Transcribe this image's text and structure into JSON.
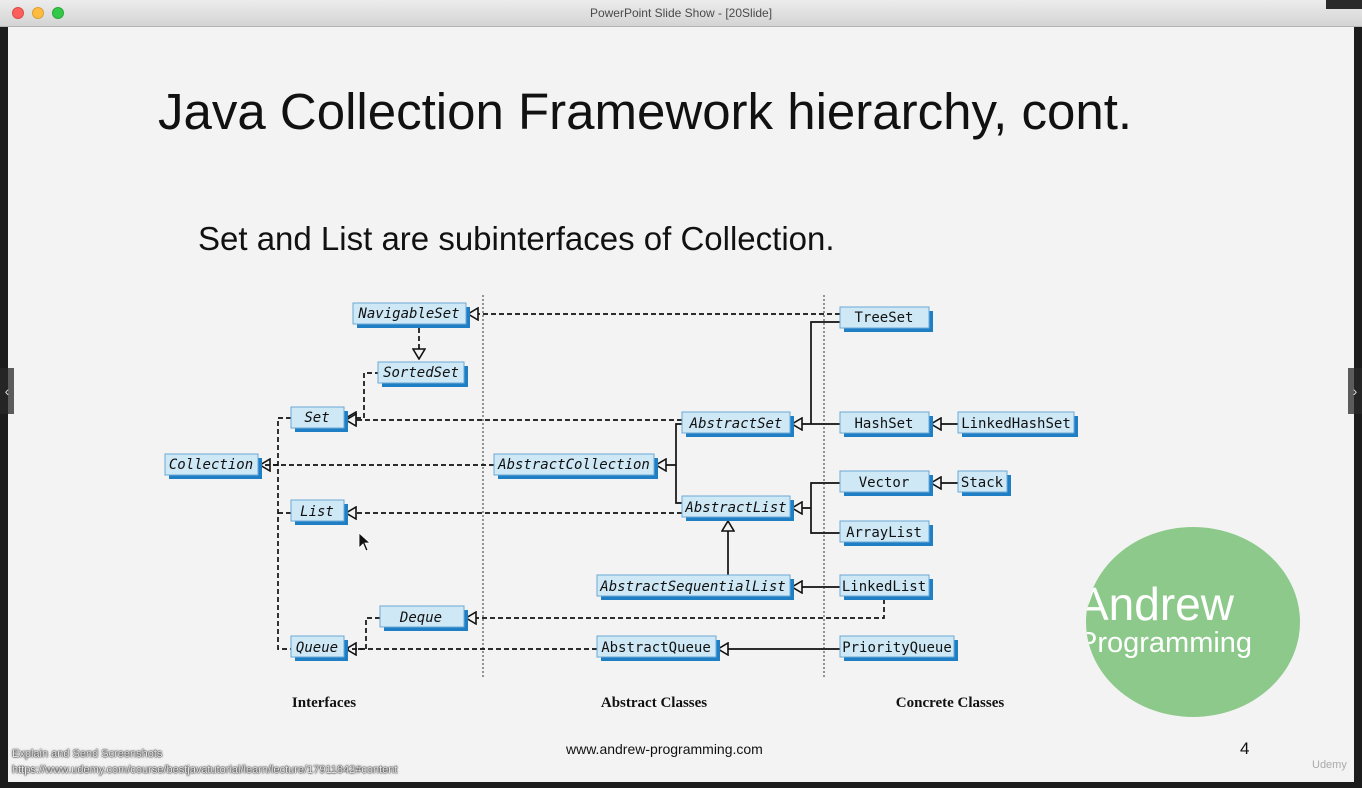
{
  "window": {
    "title": "PowerPoint Slide Show - [20Slide]"
  },
  "slide": {
    "title": "Java Collection Framework hierarchy, cont.",
    "subtitle": "Set and List are subinterfaces of Collection.",
    "footer_url": "www.andrew-programming.com",
    "page_number": "4"
  },
  "diagram": {
    "nodes": {
      "navigableset": "NavigableSet",
      "sortedset": "SortedSet",
      "set": "Set",
      "collection": "Collection",
      "list": "List",
      "deque": "Deque",
      "queue": "Queue",
      "abstractset": "AbstractSet",
      "abstractcollection": "AbstractCollection",
      "abstractlist": "AbstractList",
      "abstractsequentiallist": "AbstractSequentialList",
      "abstractqueue": "AbstractQueue",
      "treeset": "TreeSet",
      "hashset": "HashSet",
      "linkedhashset": "LinkedHashSet",
      "vector": "Vector",
      "stack": "Stack",
      "arraylist": "ArrayList",
      "linkedlist": "LinkedList",
      "priorityqueue": "PriorityQueue"
    },
    "column_labels": {
      "interfaces": "Interfaces",
      "abstract": "Abstract Classes",
      "concrete": "Concrete Classes"
    },
    "colors": {
      "node_fill": "#cfe8f6",
      "node_shadow": "#1f7fc4",
      "line": "#111111"
    }
  },
  "logo": {
    "line1": "Andrew",
    "line2": "Programming",
    "color": "#8cc98a"
  },
  "overlay": {
    "line1": "Explain and Send Screenshots",
    "line2": "https://www.udemy.com/course/bestjavatutorial/learn/lecture/17911842#content"
  },
  "player": {
    "logo_text": "Udemy"
  }
}
